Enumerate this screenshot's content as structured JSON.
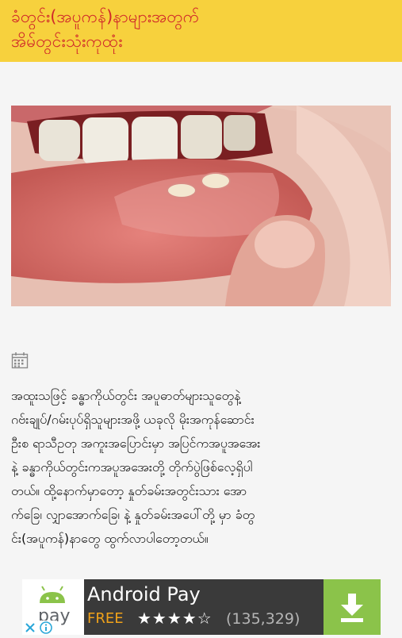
{
  "header": {
    "title_line1": "ခံတွင်း(အပူကန်)နာများအတွက်",
    "title_line2": "အိမ်တွင်းသုံးကုထုံး"
  },
  "hero": {
    "image": "mouth-ulcer-photo"
  },
  "meta": {
    "icon": "calendar-icon"
  },
  "article": {
    "lines": [
      "အထူးသဖြင့် ခန္ဓာကိုယ်တွင်း အပူဓာတ်များသူတွေနဲ့",
      "ဂဗ်းချုပ်/ဂမ်းပုပ်ရှိသူများအဖို့ ယခုလို မိုးအကုန်ဆောင်း",
      "ဦးစ ရာသီဥတု အကူးအပြောင်းမှာ အပြင်ကအပူအအေး",
      "နဲ့ ခန္ဓာကိုယ်တွင်းကအပူအအေးတို့ တိုက်ပွဲဖြစ်လေ့ရှိပါ",
      "တယ်။ ထို့နောက်မှာတော့ နှုတ်ခမ်းအတွင်းသား အော",
      "က်ခြေ၊ လျှာအောက်ခြေ၊ နဲ့ နှုတ်ခမ်းအပေါ်တို့ မှာ ခံတွ",
      "င်း(အပူကန်)နာတွေ ထွက်လာပါတော့တယ်။"
    ]
  },
  "ad": {
    "logo_text": "pay",
    "title": "Android Pay",
    "price": "FREE",
    "stars": "★★★★☆",
    "rating_count": "(135,329)",
    "colors": {
      "bg": "#3a3a3a",
      "download": "#8bc34a",
      "price": "#f0a21a"
    }
  },
  "colors": {
    "header_bg": "#f7d13d",
    "header_text": "#d0282a"
  }
}
